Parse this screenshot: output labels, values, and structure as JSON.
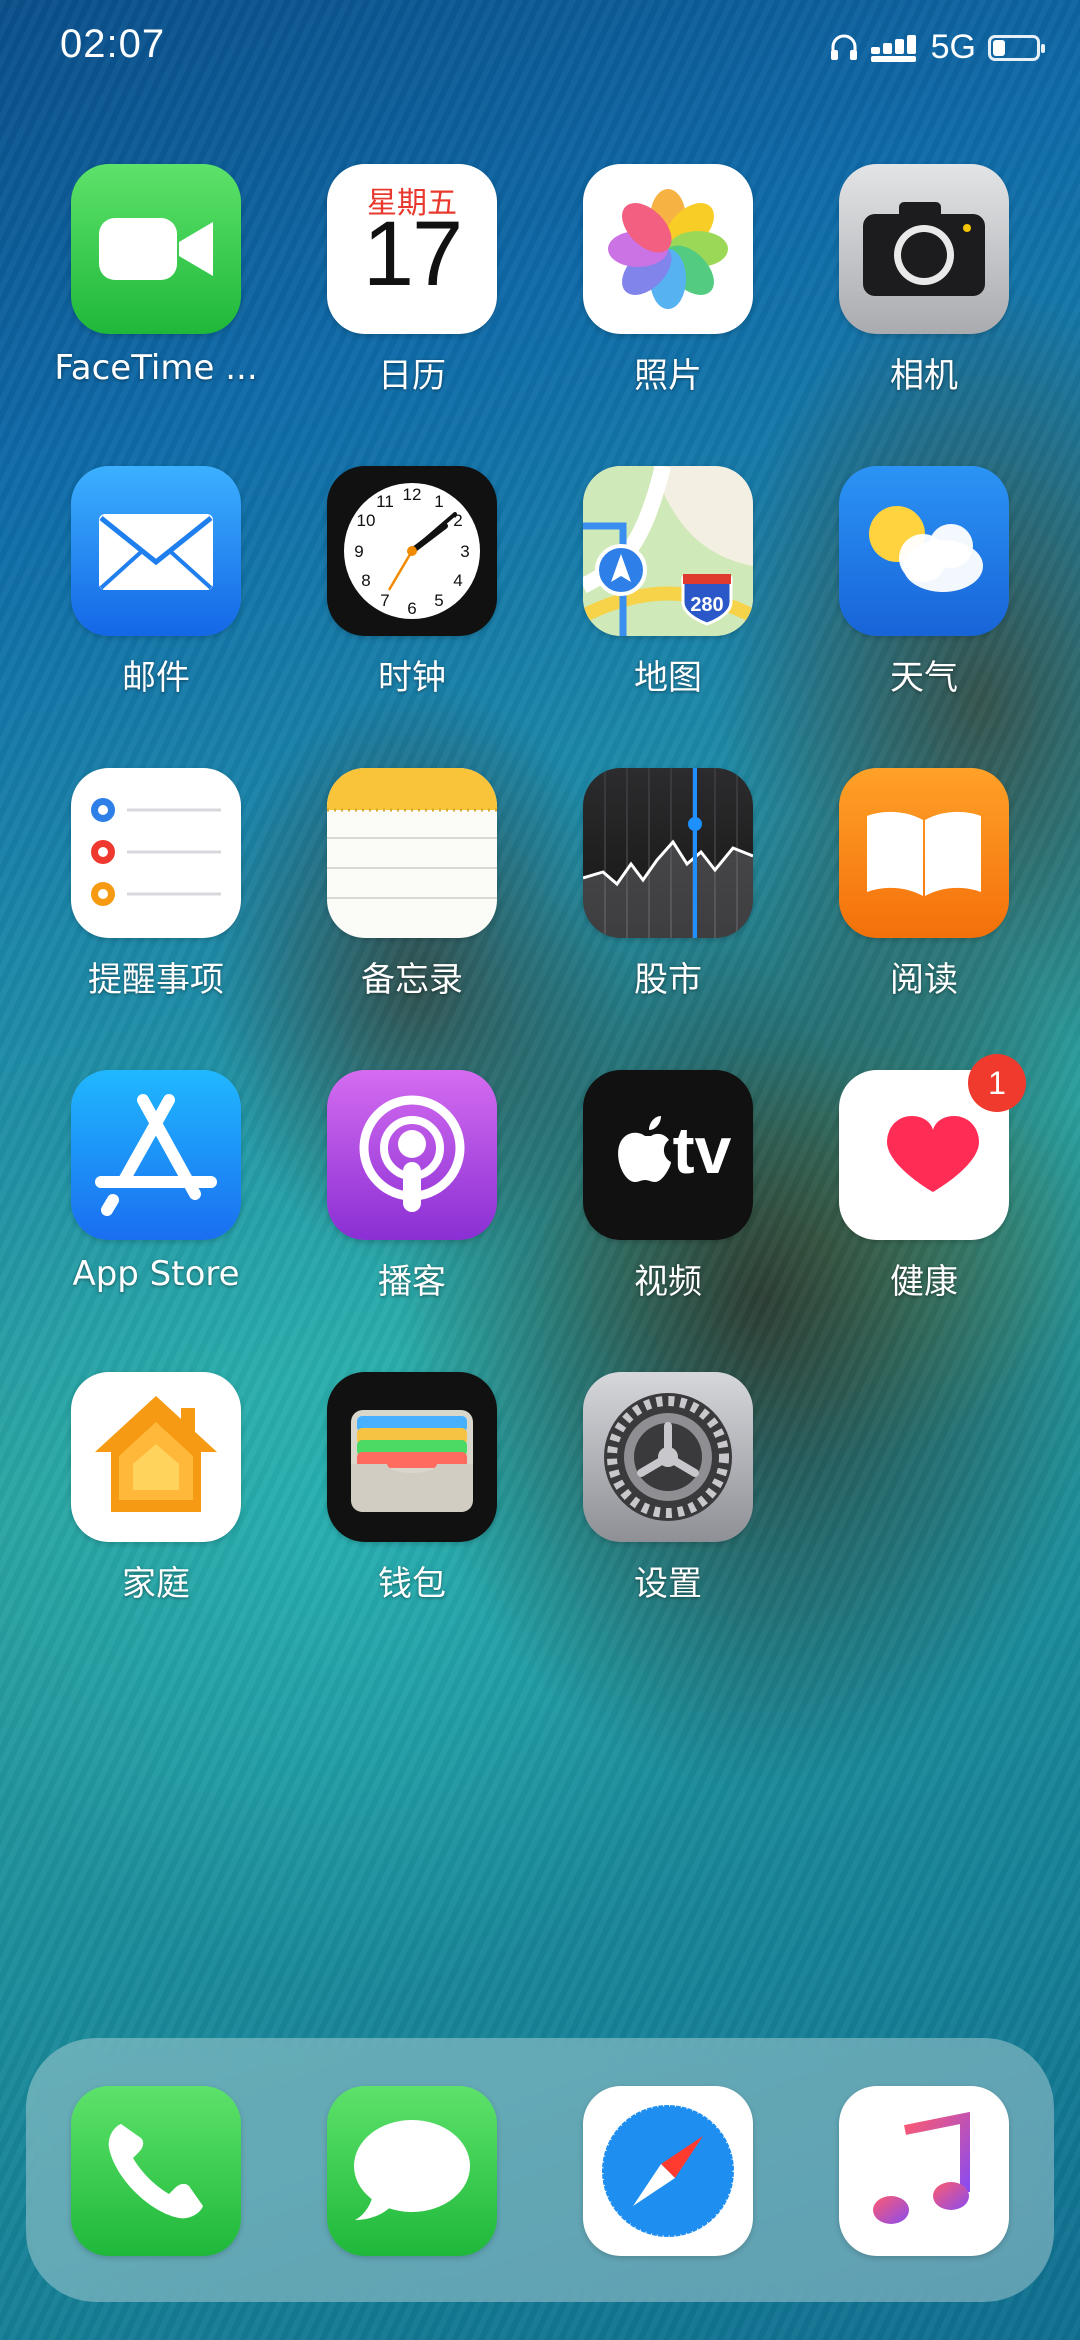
{
  "status_bar": {
    "time": "02:07",
    "network": "5G",
    "icons": [
      "headphone-icon",
      "signal-icon",
      "battery-icon"
    ]
  },
  "apps": [
    {
      "name": "facetime",
      "label": "FaceTime ...",
      "icon": "video-camera-icon"
    },
    {
      "name": "calendar",
      "label": "日历",
      "icon": "calendar-icon",
      "weekday": "星期五",
      "day": "17"
    },
    {
      "name": "photos",
      "label": "照片",
      "icon": "photos-icon"
    },
    {
      "name": "camera",
      "label": "相机",
      "icon": "camera-icon"
    },
    {
      "name": "mail",
      "label": "邮件",
      "icon": "envelope-icon"
    },
    {
      "name": "clock",
      "label": "时钟",
      "icon": "clock-icon"
    },
    {
      "name": "maps",
      "label": "地图",
      "icon": "map-icon",
      "route_sign": "280"
    },
    {
      "name": "weather",
      "label": "天气",
      "icon": "weather-icon"
    },
    {
      "name": "reminders",
      "label": "提醒事项",
      "icon": "reminders-icon"
    },
    {
      "name": "notes",
      "label": "备忘录",
      "icon": "notes-icon"
    },
    {
      "name": "stocks",
      "label": "股市",
      "icon": "stocks-icon"
    },
    {
      "name": "books",
      "label": "阅读",
      "icon": "book-icon"
    },
    {
      "name": "app-store",
      "label": "App Store",
      "icon": "app-store-icon"
    },
    {
      "name": "podcasts",
      "label": "播客",
      "icon": "podcast-icon"
    },
    {
      "name": "tv",
      "label": "视频",
      "icon": "apple-tv-icon",
      "icon_text": "tv"
    },
    {
      "name": "health",
      "label": "健康",
      "icon": "heart-icon",
      "badge": "1"
    },
    {
      "name": "home",
      "label": "家庭",
      "icon": "house-icon"
    },
    {
      "name": "wallet",
      "label": "钱包",
      "icon": "wallet-icon"
    },
    {
      "name": "settings",
      "label": "设置",
      "icon": "gear-icon"
    }
  ],
  "dock": [
    {
      "name": "phone",
      "icon": "phone-icon"
    },
    {
      "name": "messages",
      "icon": "message-bubble-icon"
    },
    {
      "name": "safari",
      "icon": "compass-icon"
    },
    {
      "name": "music",
      "icon": "music-note-icon"
    }
  ],
  "colors": {
    "badge": "#f03a2e",
    "calendar_weekday": "#e9392e"
  }
}
